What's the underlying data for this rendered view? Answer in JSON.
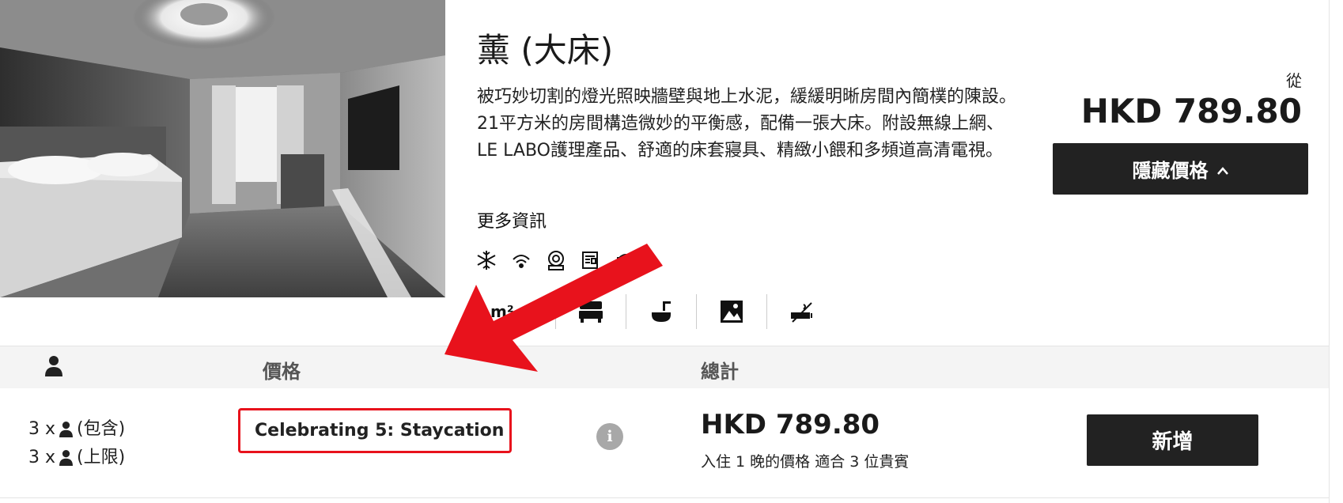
{
  "room": {
    "title": "薰 (大床)",
    "description": "被巧妙切割的燈光照映牆壁與地上水泥，緩緩明晰房間內簡樸的陳設。21平方米的房間構造微妙的平衡感，配備一張大床。附設無線上網、LE LABO護理產品、舒適的床套寢具、精緻小餵和多頻道高清電視。",
    "more_info": "更多資訊",
    "amenities_top": [
      "snowflake-icon",
      "wifi-icon",
      "safe-icon",
      "newspaper-icon",
      "phone-icon"
    ],
    "amenities_bottom": {
      "size_label": "m²",
      "icons": [
        "bed-icon",
        "shower-icon",
        "city-view-icon",
        "no-smoking-icon"
      ]
    }
  },
  "price": {
    "from_label": "從",
    "amount": "HKD 789.80",
    "hide_button": "隱藏價格",
    "hide_button_icon": "chevron-up-icon"
  },
  "table": {
    "header": {
      "guests_icon": "person-icon",
      "price": "價格",
      "total": "總計"
    },
    "rows": [
      {
        "guests_included": "3 x",
        "guests_included_label": "(包含)",
        "guests_max": "3 x",
        "guests_max_label": "(上限)",
        "rate_name": "Celebrating 5: Staycation",
        "info_icon_text": "i",
        "total": "HKD 789.80",
        "total_note": "入住 1 晚的價格 適合 3 位貴賓",
        "add_button": "新增"
      }
    ]
  },
  "colors": {
    "button_dark": "#222222",
    "highlight_red": "#e8121c",
    "header_bg": "#f4f4f4",
    "info_grey": "#a8a8a8"
  }
}
